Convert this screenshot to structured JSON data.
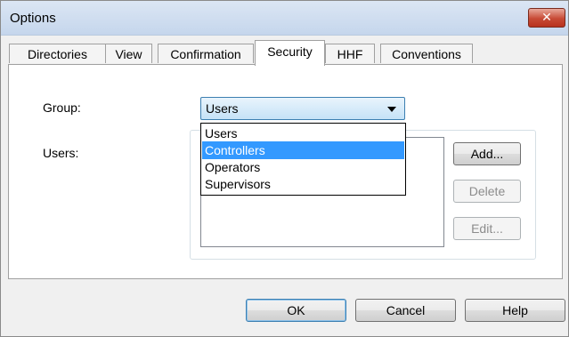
{
  "window": {
    "title": "Options",
    "close_glyph": "✕"
  },
  "tabs": [
    {
      "label": "Directories",
      "active": false
    },
    {
      "label": "View",
      "active": false
    },
    {
      "label": "Confirmation",
      "active": false
    },
    {
      "label": "Security",
      "active": true
    },
    {
      "label": "HHF",
      "active": false
    },
    {
      "label": "Conventions",
      "active": false
    }
  ],
  "security": {
    "group_label": "Group:",
    "group_value": "Users",
    "users_label": "Users:",
    "group_options": [
      "Users",
      "Controllers",
      "Operators",
      "Supervisors"
    ],
    "highlighted_option": "Controllers",
    "side_buttons": {
      "add": "Add...",
      "delete": "Delete",
      "edit": "Edit..."
    }
  },
  "footer": {
    "ok": "OK",
    "cancel": "Cancel",
    "help": "Help"
  },
  "colors": {
    "selection": "#3399ff",
    "close_button": "#c74a35"
  }
}
